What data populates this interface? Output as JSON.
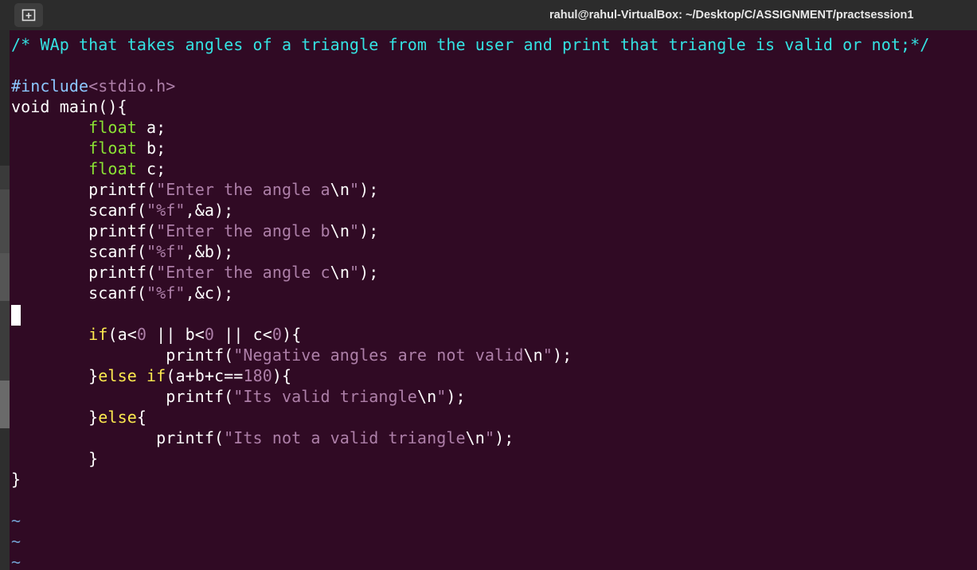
{
  "window": {
    "title": "rahul@rahul-VirtualBox: ~/Desktop/C/ASSIGNMENT/practsession1"
  },
  "toolbar": {
    "new_tab_icon": "new-tab-icon"
  },
  "colors": {
    "background": "#300a24",
    "comment": "#34e2e2",
    "preprocessor": "#8cc7ff",
    "type": "#8ae234",
    "string": "#ad7fa8",
    "keyword": "#fce94f",
    "tilde": "#729fcf",
    "text": "#ffffff"
  },
  "editor": {
    "lines": [
      [
        {
          "t": "/* WAp that takes angles of a triangle from the user and print that triangle is valid or not;*/",
          "c": "comment"
        }
      ],
      [],
      [
        {
          "t": "#include",
          "c": "pre"
        },
        {
          "t": "<stdio.h>",
          "c": "inc"
        }
      ],
      [
        {
          "t": "void main(){",
          "c": "plain"
        }
      ],
      [
        {
          "t": "        ",
          "c": "plain"
        },
        {
          "t": "float",
          "c": "type"
        },
        {
          "t": " a;",
          "c": "plain"
        }
      ],
      [
        {
          "t": "        ",
          "c": "plain"
        },
        {
          "t": "float",
          "c": "type"
        },
        {
          "t": " b;",
          "c": "plain"
        }
      ],
      [
        {
          "t": "        ",
          "c": "plain"
        },
        {
          "t": "float",
          "c": "type"
        },
        {
          "t": " c;",
          "c": "plain"
        }
      ],
      [
        {
          "t": "        printf(",
          "c": "plain"
        },
        {
          "t": "\"Enter the angle a",
          "c": "str"
        },
        {
          "t": "\\n",
          "c": "esc"
        },
        {
          "t": "\"",
          "c": "str"
        },
        {
          "t": ");",
          "c": "plain"
        }
      ],
      [
        {
          "t": "        scanf(",
          "c": "plain"
        },
        {
          "t": "\"%f\"",
          "c": "str"
        },
        {
          "t": ",&a);",
          "c": "plain"
        }
      ],
      [
        {
          "t": "        printf(",
          "c": "plain"
        },
        {
          "t": "\"Enter the angle b",
          "c": "str"
        },
        {
          "t": "\\n",
          "c": "esc"
        },
        {
          "t": "\"",
          "c": "str"
        },
        {
          "t": ");",
          "c": "plain"
        }
      ],
      [
        {
          "t": "        scanf(",
          "c": "plain"
        },
        {
          "t": "\"%f\"",
          "c": "str"
        },
        {
          "t": ",&b);",
          "c": "plain"
        }
      ],
      [
        {
          "t": "        printf(",
          "c": "plain"
        },
        {
          "t": "\"Enter the angle c",
          "c": "str"
        },
        {
          "t": "\\n",
          "c": "esc"
        },
        {
          "t": "\"",
          "c": "str"
        },
        {
          "t": ");",
          "c": "plain"
        }
      ],
      [
        {
          "t": "        scanf(",
          "c": "plain"
        },
        {
          "t": "\"%f\"",
          "c": "str"
        },
        {
          "t": ",&c);",
          "c": "plain"
        }
      ],
      [],
      [
        {
          "t": "        ",
          "c": "plain"
        },
        {
          "t": "if",
          "c": "kw"
        },
        {
          "t": "(a<",
          "c": "plain"
        },
        {
          "t": "0",
          "c": "num"
        },
        {
          "t": " || b<",
          "c": "plain"
        },
        {
          "t": "0",
          "c": "num"
        },
        {
          "t": " || c<",
          "c": "plain"
        },
        {
          "t": "0",
          "c": "num"
        },
        {
          "t": "){",
          "c": "plain"
        }
      ],
      [
        {
          "t": "                printf(",
          "c": "plain"
        },
        {
          "t": "\"Negative angles are not valid",
          "c": "str"
        },
        {
          "t": "\\n",
          "c": "esc"
        },
        {
          "t": "\"",
          "c": "str"
        },
        {
          "t": ");",
          "c": "plain"
        }
      ],
      [
        {
          "t": "        }",
          "c": "plain"
        },
        {
          "t": "else",
          "c": "kw"
        },
        {
          "t": " ",
          "c": "plain"
        },
        {
          "t": "if",
          "c": "kw"
        },
        {
          "t": "(a+b+c==",
          "c": "plain"
        },
        {
          "t": "180",
          "c": "num"
        },
        {
          "t": "){",
          "c": "plain"
        }
      ],
      [
        {
          "t": "                printf(",
          "c": "plain"
        },
        {
          "t": "\"Its valid triangle",
          "c": "str"
        },
        {
          "t": "\\n",
          "c": "esc"
        },
        {
          "t": "\"",
          "c": "str"
        },
        {
          "t": ");",
          "c": "plain"
        }
      ],
      [
        {
          "t": "        }",
          "c": "plain"
        },
        {
          "t": "else",
          "c": "kw"
        },
        {
          "t": "{",
          "c": "plain"
        }
      ],
      [
        {
          "t": "               printf(",
          "c": "plain"
        },
        {
          "t": "\"Its not a valid triangle",
          "c": "str"
        },
        {
          "t": "\\n",
          "c": "esc"
        },
        {
          "t": "\"",
          "c": "str"
        },
        {
          "t": ");",
          "c": "plain"
        }
      ],
      [
        {
          "t": "        }",
          "c": "plain"
        }
      ],
      [
        {
          "t": "}",
          "c": "plain"
        }
      ],
      [],
      [
        {
          "t": "~",
          "c": "tilde"
        }
      ],
      [
        {
          "t": "~",
          "c": "tilde"
        }
      ],
      [
        {
          "t": "~",
          "c": "tilde"
        }
      ]
    ]
  }
}
